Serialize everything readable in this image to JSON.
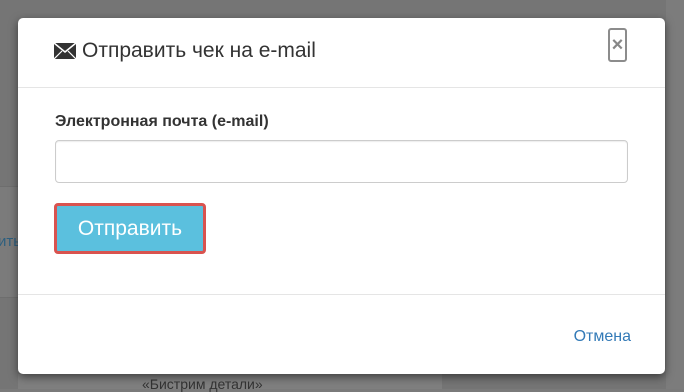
{
  "background": {
    "left_text": "ить",
    "bottom_text": "«Бистрим детали»"
  },
  "modal": {
    "title": "Отправить чек на e-mail",
    "title_icon": "envelope-icon",
    "close_label": "×",
    "email_label": "Электронная почта (e-mail)",
    "email_value": "",
    "email_placeholder": "",
    "submit_label": "Отправить",
    "cancel_label": "Отмена"
  },
  "colors": {
    "submit_bg": "#5bc0de",
    "submit_border": "#d9534f",
    "link": "#337ab7"
  }
}
